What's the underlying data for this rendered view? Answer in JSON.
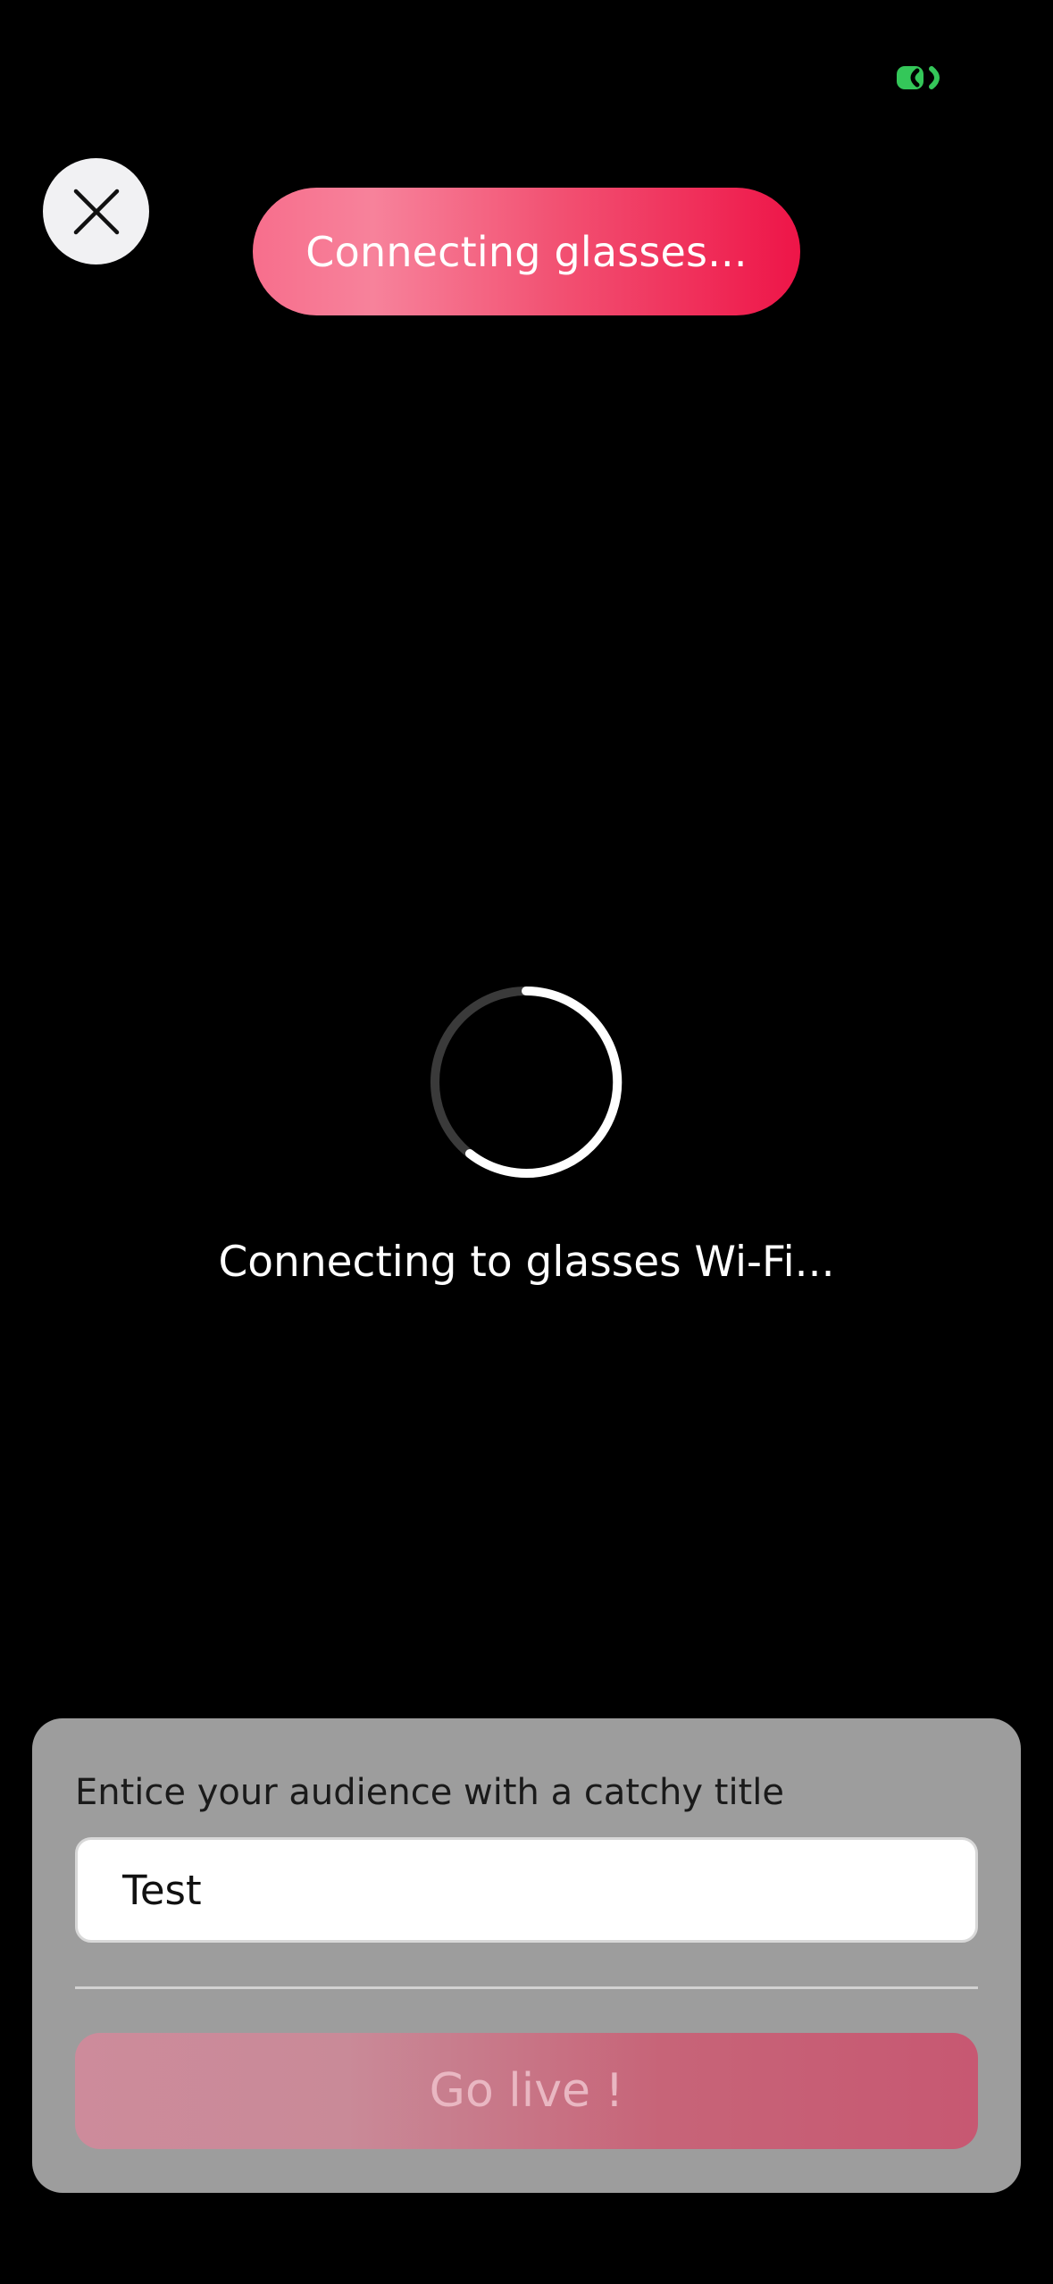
{
  "status": {
    "indicator_icon": "green-status-indicator-icon",
    "indicator_color": "#34c759"
  },
  "header": {
    "close_icon": "close-icon",
    "banner_text": "Connecting glasses..."
  },
  "loading": {
    "spinner_icon": "loading-spinner-icon",
    "message": "Connecting to glasses Wi-Fi..."
  },
  "go_live_panel": {
    "title_prompt": "Entice your audience with a catchy title",
    "title_value": "Test",
    "go_live_label": "Go live !"
  },
  "colors": {
    "background": "#000000",
    "banner_gradient_start": "#f7829b",
    "banner_gradient_end": "#ee1548",
    "panel_background": "#9d9d9d",
    "go_live_disabled": "#c76478"
  }
}
